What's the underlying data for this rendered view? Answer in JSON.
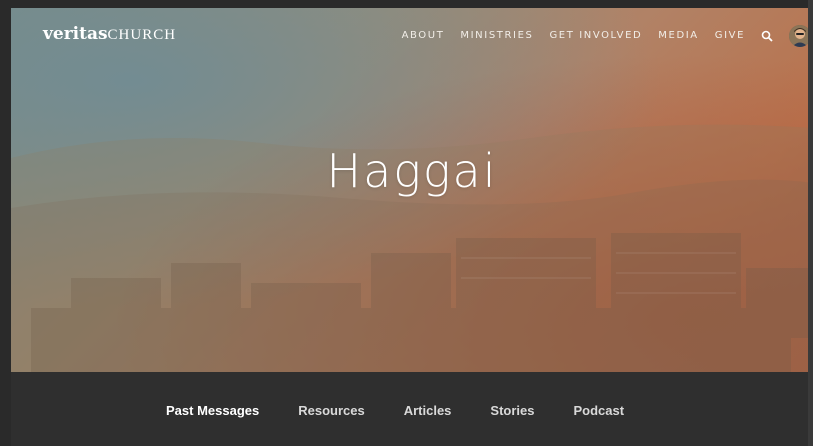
{
  "header": {
    "logo_main": "veritas",
    "logo_sub": "CHURCH",
    "nav": [
      "ABOUT",
      "MINISTRIES",
      "GET INVOLVED",
      "MEDIA",
      "GIVE"
    ],
    "icons": {
      "search": "search-icon",
      "avatar": "avatar"
    }
  },
  "hero": {
    "title": "Haggai"
  },
  "subnav": {
    "items": [
      "Past Messages",
      "Resources",
      "Articles",
      "Stories",
      "Podcast"
    ],
    "active": "Past Messages"
  },
  "colors": {
    "hero_start": "#7d8d84",
    "hero_end": "#a9593d",
    "subnav_bg": "#2f2f2f",
    "text": "#ffffff"
  }
}
